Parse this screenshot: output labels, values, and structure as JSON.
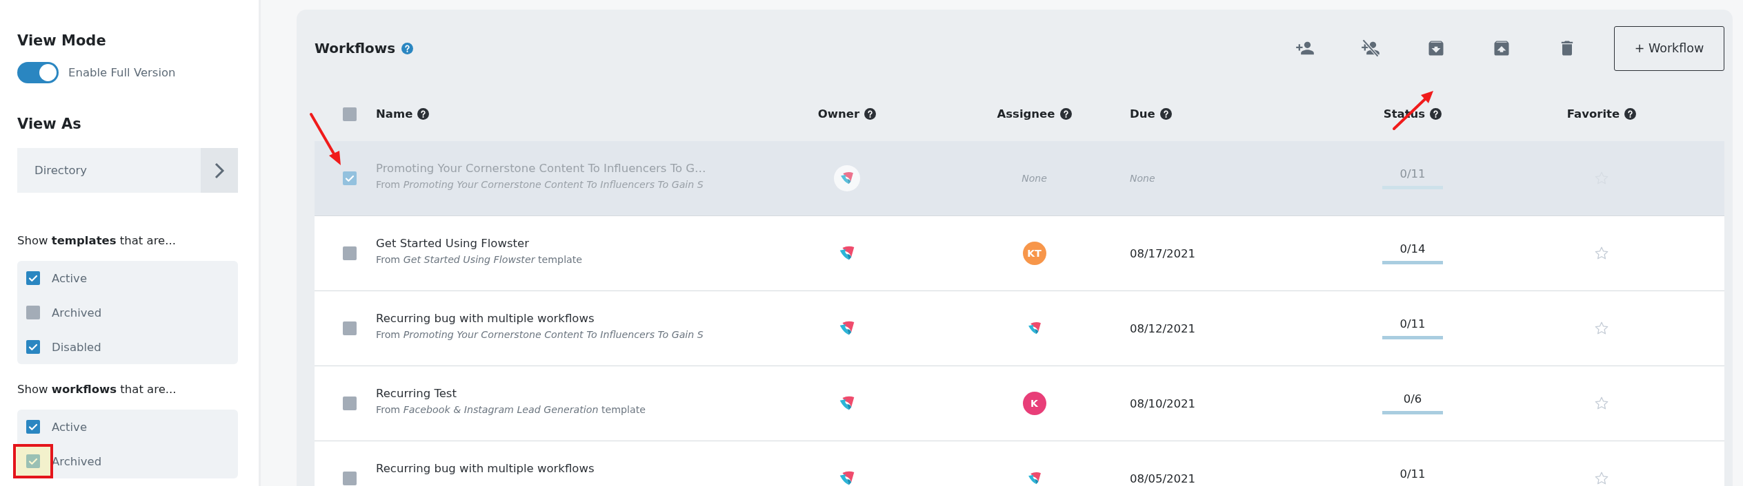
{
  "sidebar": {
    "view_mode": {
      "title": "View Mode",
      "toggle": {
        "label": "Enable Full Version",
        "on": true
      }
    },
    "view_as": {
      "title": "View As",
      "value": "Directory"
    },
    "filter_groups": [
      {
        "heading": "Show **templates** that are...",
        "options": [
          {
            "label": "Active",
            "checked": true,
            "highlighted": false
          },
          {
            "label": "Archived",
            "checked": false,
            "highlighted": false
          },
          {
            "label": "Disabled",
            "checked": true,
            "highlighted": false
          }
        ]
      },
      {
        "heading": "Show **workflows** that are...",
        "options": [
          {
            "label": "Active",
            "checked": true,
            "highlighted": false
          },
          {
            "label": "Archived",
            "checked": true,
            "highlighted": true
          }
        ]
      }
    ]
  },
  "workflows": {
    "title": "Workflows",
    "new_button": "+ Workflow",
    "select_all_checked": false,
    "columns": [
      {
        "label": "Name"
      },
      {
        "label": "Owner"
      },
      {
        "label": "Assignee"
      },
      {
        "label": "Due"
      },
      {
        "label": "Status"
      },
      {
        "label": "Favorite"
      }
    ],
    "rows": [
      {
        "selected": true,
        "archived": true,
        "name": "Promoting Your Cornerstone Content To Influencers To G…",
        "source": "From *Promoting Your Cornerstone Content To Influencers To Gain S*",
        "owner": {
          "kind": "logo"
        },
        "assignee": {
          "kind": "none",
          "text": "None"
        },
        "due": {
          "kind": "none",
          "text": "None"
        },
        "status": "0/11",
        "level": 0,
        "favorite": false
      },
      {
        "selected": false,
        "archived": false,
        "name": "Get Started Using Flowster",
        "source": "From *Get Started Using Flowster* template",
        "owner": {
          "kind": "logo"
        },
        "assignee": {
          "kind": "initials",
          "text": "KT",
          "color": "#f7964a"
        },
        "due": {
          "kind": "date",
          "text": "08/17/2021"
        },
        "status": "0/14",
        "level": 0,
        "favorite": false
      },
      {
        "selected": false,
        "archived": false,
        "name": "Recurring bug with multiple workflows",
        "source": "From *Promoting Your Cornerstone Content To Influencers To Gain S*",
        "owner": {
          "kind": "logo"
        },
        "assignee": {
          "kind": "logo"
        },
        "due": {
          "kind": "date",
          "text": "08/12/2021"
        },
        "status": "0/11",
        "level": 0,
        "favorite": false
      },
      {
        "selected": false,
        "archived": false,
        "name": "Recurring Test",
        "source": "From *Facebook & Instagram Lead Generation* template",
        "owner": {
          "kind": "logo"
        },
        "assignee": {
          "kind": "initials",
          "text": "K",
          "color": "#e83e78"
        },
        "due": {
          "kind": "date",
          "text": "08/10/2021"
        },
        "status": "0/6",
        "level": 0,
        "favorite": false
      },
      {
        "selected": false,
        "archived": false,
        "name": "Recurring bug with multiple workflows",
        "owner": {
          "kind": "logo"
        },
        "assignee": {
          "kind": "logo"
        },
        "due": {
          "kind": "date",
          "text": "08/05/2021"
        },
        "status": "0/11",
        "level": 0,
        "favorite": false
      }
    ]
  }
}
